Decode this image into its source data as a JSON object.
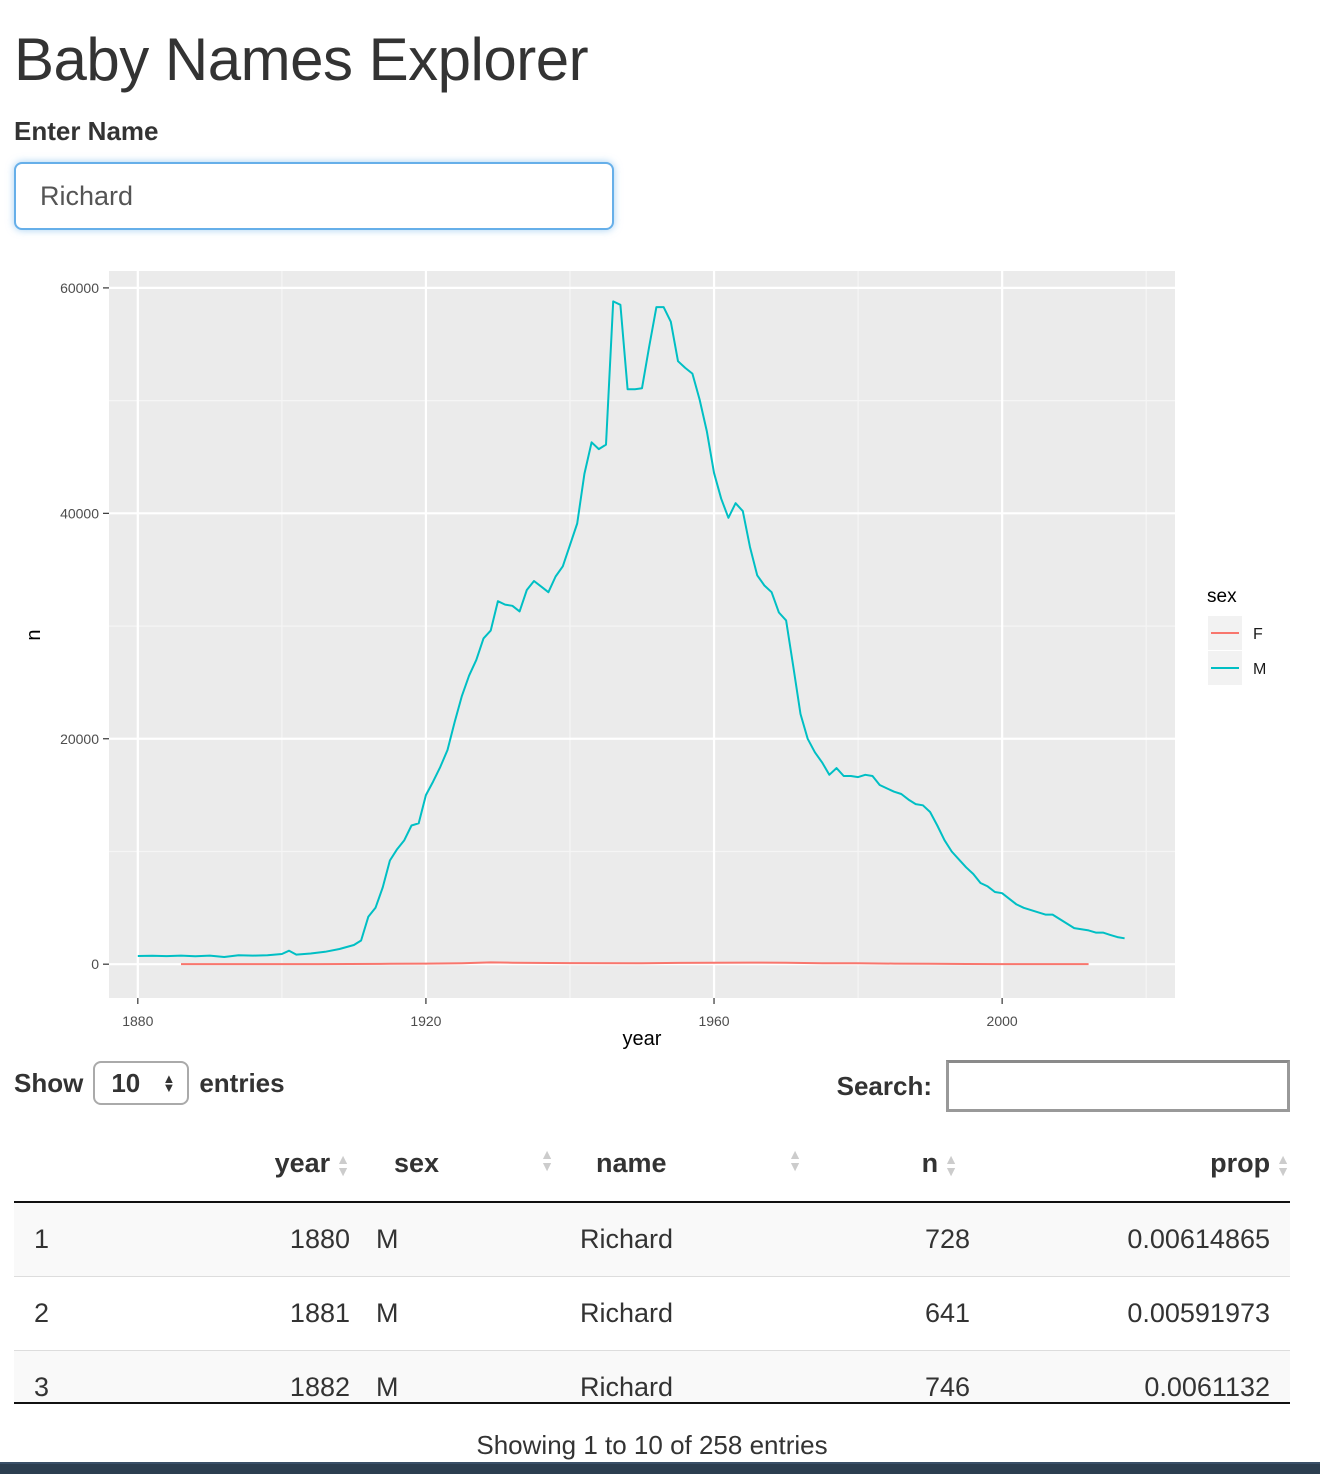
{
  "app": {
    "title": "Baby Names Explorer"
  },
  "input": {
    "label": "Enter Name",
    "value": "Richard"
  },
  "chart_data": {
    "type": "line",
    "title": "",
    "xlabel": "year",
    "ylabel": "n",
    "xlim": [
      1876,
      2024
    ],
    "ylim": [
      -3000,
      61500
    ],
    "xticks": [
      1880,
      1920,
      1960,
      2000
    ],
    "yticks": [
      0,
      20000,
      40000,
      60000
    ],
    "xtick_labels": [
      "1880",
      "1920",
      "1960",
      "2000"
    ],
    "ytick_labels": [
      "0",
      "20000",
      "40000",
      "60000"
    ],
    "grid": true,
    "legend": {
      "title": "sex",
      "position": "right",
      "entries": [
        "F",
        "M"
      ]
    },
    "series": [
      {
        "name": "M",
        "color": "#00BFC4",
        "points": [
          [
            1880,
            728
          ],
          [
            1882,
            746
          ],
          [
            1884,
            720
          ],
          [
            1886,
            760
          ],
          [
            1888,
            700
          ],
          [
            1890,
            760
          ],
          [
            1892,
            640
          ],
          [
            1894,
            790
          ],
          [
            1896,
            760
          ],
          [
            1898,
            800
          ],
          [
            1900,
            900
          ],
          [
            1901,
            1200
          ],
          [
            1902,
            850
          ],
          [
            1904,
            950
          ],
          [
            1906,
            1100
          ],
          [
            1908,
            1350
          ],
          [
            1910,
            1700
          ],
          [
            1911,
            2100
          ],
          [
            1912,
            4200
          ],
          [
            1913,
            5000
          ],
          [
            1914,
            6800
          ],
          [
            1915,
            9200
          ],
          [
            1916,
            10200
          ],
          [
            1917,
            11000
          ],
          [
            1918,
            12300
          ],
          [
            1919,
            12500
          ],
          [
            1920,
            15000
          ],
          [
            1921,
            16200
          ],
          [
            1922,
            17500
          ],
          [
            1923,
            19000
          ],
          [
            1924,
            21500
          ],
          [
            1925,
            23800
          ],
          [
            1926,
            25600
          ],
          [
            1927,
            27000
          ],
          [
            1928,
            28900
          ],
          [
            1929,
            29600
          ],
          [
            1930,
            32200
          ],
          [
            1931,
            31900
          ],
          [
            1932,
            31800
          ],
          [
            1933,
            31300
          ],
          [
            1934,
            33200
          ],
          [
            1935,
            34000
          ],
          [
            1936,
            33500
          ],
          [
            1937,
            33000
          ],
          [
            1938,
            34400
          ],
          [
            1939,
            35300
          ],
          [
            1940,
            37200
          ],
          [
            1941,
            39100
          ],
          [
            1942,
            43500
          ],
          [
            1943,
            46300
          ],
          [
            1944,
            45700
          ],
          [
            1945,
            46100
          ],
          [
            1946,
            58800
          ],
          [
            1947,
            58500
          ],
          [
            1948,
            51000
          ],
          [
            1949,
            51000
          ],
          [
            1950,
            51100
          ],
          [
            1951,
            54800
          ],
          [
            1952,
            58300
          ],
          [
            1953,
            58300
          ],
          [
            1954,
            57000
          ],
          [
            1955,
            53500
          ],
          [
            1956,
            52900
          ],
          [
            1957,
            52400
          ],
          [
            1958,
            50100
          ],
          [
            1959,
            47300
          ],
          [
            1960,
            43600
          ],
          [
            1961,
            41300
          ],
          [
            1962,
            39600
          ],
          [
            1963,
            40900
          ],
          [
            1964,
            40200
          ],
          [
            1965,
            37000
          ],
          [
            1966,
            34500
          ],
          [
            1967,
            33600
          ],
          [
            1968,
            33000
          ],
          [
            1969,
            31200
          ],
          [
            1970,
            30500
          ],
          [
            1971,
            26400
          ],
          [
            1972,
            22200
          ],
          [
            1973,
            20000
          ],
          [
            1974,
            18800
          ],
          [
            1975,
            17900
          ],
          [
            1976,
            16800
          ],
          [
            1977,
            17400
          ],
          [
            1978,
            16700
          ],
          [
            1979,
            16700
          ],
          [
            1980,
            16600
          ],
          [
            1981,
            16800
          ],
          [
            1982,
            16700
          ],
          [
            1983,
            15900
          ],
          [
            1984,
            15600
          ],
          [
            1985,
            15300
          ],
          [
            1986,
            15100
          ],
          [
            1987,
            14600
          ],
          [
            1988,
            14200
          ],
          [
            1989,
            14100
          ],
          [
            1990,
            13500
          ],
          [
            1991,
            12300
          ],
          [
            1992,
            11000
          ],
          [
            1993,
            10000
          ],
          [
            1994,
            9300
          ],
          [
            1995,
            8600
          ],
          [
            1996,
            8000
          ],
          [
            1997,
            7200
          ],
          [
            1998,
            6900
          ],
          [
            1999,
            6400
          ],
          [
            2000,
            6300
          ],
          [
            2001,
            5800
          ],
          [
            2002,
            5300
          ],
          [
            2003,
            5000
          ],
          [
            2004,
            4800
          ],
          [
            2005,
            4600
          ],
          [
            2006,
            4400
          ],
          [
            2007,
            4400
          ],
          [
            2008,
            4000
          ],
          [
            2009,
            3600
          ],
          [
            2010,
            3200
          ],
          [
            2011,
            3100
          ],
          [
            2012,
            3000
          ],
          [
            2013,
            2800
          ],
          [
            2014,
            2800
          ],
          [
            2015,
            2600
          ],
          [
            2016,
            2400
          ],
          [
            2017,
            2300
          ]
        ]
      },
      {
        "name": "F",
        "color": "#F8766D",
        "points": [
          [
            1886,
            5
          ],
          [
            1895,
            10
          ],
          [
            1905,
            12
          ],
          [
            1915,
            30
          ],
          [
            1920,
            50
          ],
          [
            1925,
            90
          ],
          [
            1929,
            160
          ],
          [
            1932,
            130
          ],
          [
            1940,
            100
          ],
          [
            1950,
            80
          ],
          [
            1955,
            110
          ],
          [
            1960,
            120
          ],
          [
            1965,
            140
          ],
          [
            1970,
            120
          ],
          [
            1975,
            90
          ],
          [
            1980,
            80
          ],
          [
            1985,
            50
          ],
          [
            1990,
            30
          ],
          [
            1995,
            20
          ],
          [
            2000,
            12
          ],
          [
            2005,
            8
          ],
          [
            2012,
            5
          ]
        ]
      }
    ]
  },
  "table_controls": {
    "show_label": "Show",
    "length_value": "10",
    "entries_label": "entries",
    "search_label": "Search:"
  },
  "table": {
    "headers": [
      "",
      "year",
      "sex",
      "name",
      "n",
      "prop"
    ],
    "rows": [
      [
        "1",
        "1880",
        "M",
        "Richard",
        "728",
        "0.00614865"
      ],
      [
        "2",
        "1881",
        "M",
        "Richard",
        "641",
        "0.00591973"
      ],
      [
        "3",
        "1882",
        "M",
        "Richard",
        "746",
        "0.0061132"
      ]
    ],
    "info": "Showing 1 to 10 of 258 entries"
  }
}
